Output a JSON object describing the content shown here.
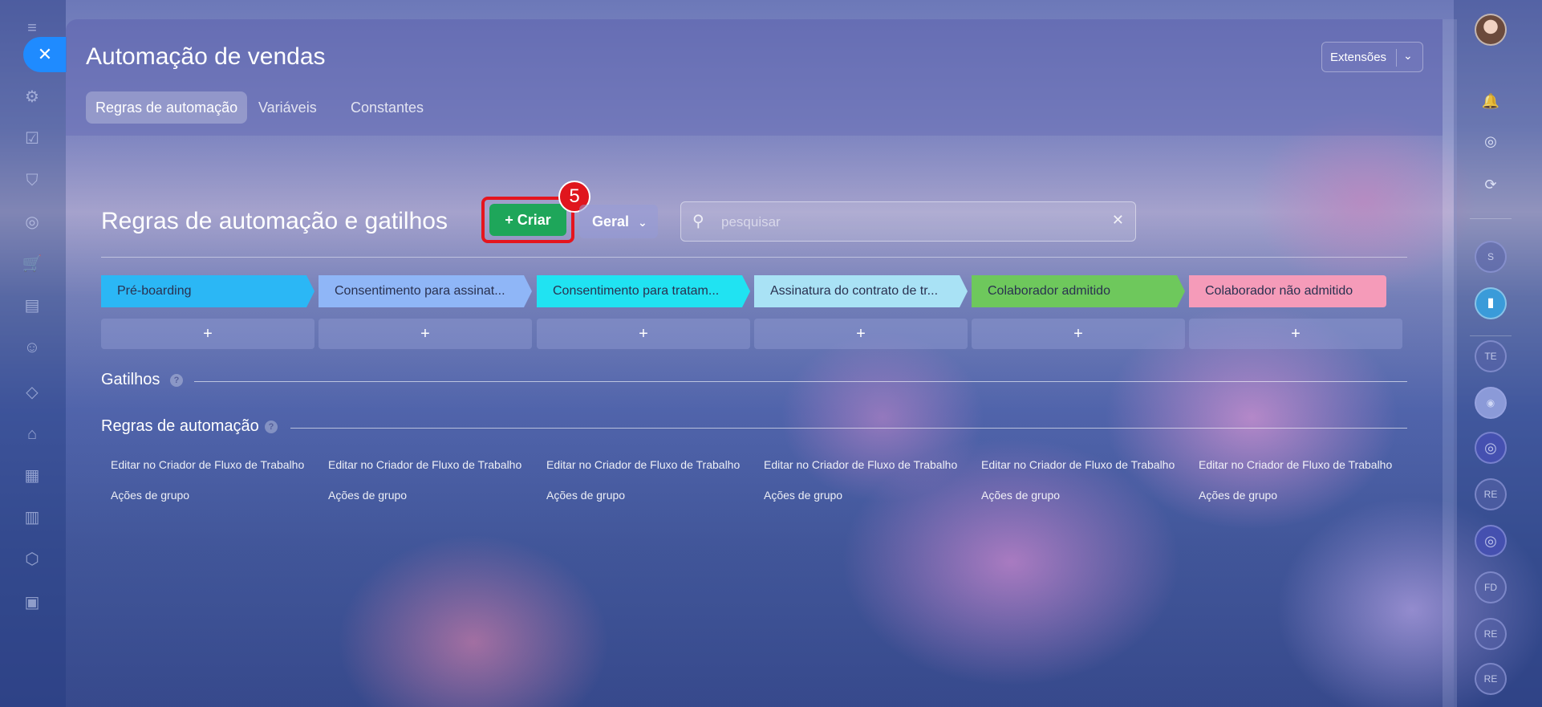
{
  "app": {
    "title": "Automação de vendas",
    "extensions_label": "Extensões"
  },
  "tabs": [
    {
      "label": "Regras de automação",
      "active": true
    },
    {
      "label": "Variáveis",
      "active": false
    },
    {
      "label": "Constantes",
      "active": false
    }
  ],
  "main": {
    "section_title": "Regras de automação e gatilhos",
    "create_label": "+ Criar",
    "step_badge": "5",
    "geral_label": "Geral",
    "search_placeholder": "pesquisar"
  },
  "stages": [
    {
      "label": "Pré-boarding",
      "color": "#2bb7f5"
    },
    {
      "label": "Consentimento para assinat...",
      "color": "#8fb6f7"
    },
    {
      "label": "Consentimento para tratam...",
      "color": "#20e3f2"
    },
    {
      "label": "Assinatura do contrato de tr...",
      "color": "#a9e2f5"
    },
    {
      "label": "Colaborador admitido",
      "color": "#6ec85c"
    },
    {
      "label": "Colaborador não admitido",
      "color": "#f59bb9"
    }
  ],
  "add_symbol": "+",
  "triggers_title": "Gatilhos",
  "rules_title": "Regras de automação",
  "help_symbol": "?",
  "columns": [
    {
      "edit": "Editar no Criador de Fluxo de Trabalho",
      "group": "Ações de grupo"
    },
    {
      "edit": "Editar no Criador de Fluxo de Trabalho",
      "group": "Ações de grupo"
    },
    {
      "edit": "Editar no Criador de Fluxo de Trabalho",
      "group": "Ações de grupo"
    },
    {
      "edit": "Editar no Criador de Fluxo de Trabalho",
      "group": "Ações de grupo"
    },
    {
      "edit": "Editar no Criador de Fluxo de Trabalho",
      "group": "Ações de grupo"
    },
    {
      "edit": "Editar no Criador de Fluxo de Trabalho",
      "group": "Ações de grupo"
    }
  ],
  "right_rail": {
    "avatars": [
      "S",
      "TE",
      "RE",
      "FD",
      "RE",
      "RE"
    ]
  },
  "icons": {
    "close": "close-icon",
    "search": "search-icon",
    "clear": "clear-icon",
    "bell": "bell-icon"
  },
  "colors": {
    "create_button": "#1ea65a",
    "highlight": "#e5151e",
    "close_button": "#1f8bff"
  }
}
